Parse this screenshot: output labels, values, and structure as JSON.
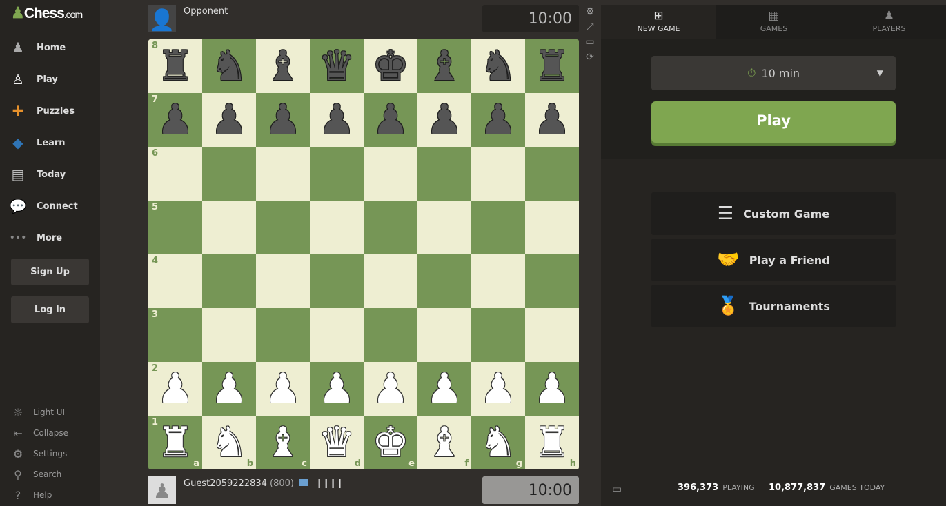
{
  "brand": {
    "name": "Chess",
    "suffix": ".com"
  },
  "sidebar": {
    "items": [
      {
        "label": "Home",
        "icon": "home-pawn-icon",
        "glyph": "♟",
        "color": "#aaa"
      },
      {
        "label": "Play",
        "icon": "play-hand-icon",
        "glyph": "♙",
        "color": "#eee"
      },
      {
        "label": "Puzzles",
        "icon": "puzzle-icon",
        "glyph": "✚",
        "color": "#e6912c"
      },
      {
        "label": "Learn",
        "icon": "graduation-cap-icon",
        "glyph": "◆",
        "color": "#2f74b5"
      },
      {
        "label": "Today",
        "icon": "newspaper-icon",
        "glyph": "▤",
        "color": "#bbb"
      },
      {
        "label": "Connect",
        "icon": "chat-bubbles-icon",
        "glyph": "💬",
        "color": "#ddd"
      },
      {
        "label": "More",
        "icon": "more-dots-icon",
        "glyph": "•••",
        "color": "#888"
      }
    ],
    "signup": "Sign Up",
    "login": "Log In",
    "footer": [
      {
        "label": "Light UI",
        "icon": "sun-icon",
        "glyph": "☼"
      },
      {
        "label": "Collapse",
        "icon": "collapse-icon",
        "glyph": "⇤"
      },
      {
        "label": "Settings",
        "icon": "gear-icon",
        "glyph": "⚙"
      },
      {
        "label": "Search",
        "icon": "search-icon",
        "glyph": "⚲"
      },
      {
        "label": "Help",
        "icon": "help-icon",
        "glyph": "?"
      }
    ]
  },
  "opponent": {
    "name": "Opponent",
    "clock": "10:00"
  },
  "player": {
    "name": "Guest2059222834",
    "rating": "(800)",
    "clock": "10:00",
    "flag_icon": "international-flag-icon",
    "connection_icon": "signal-bars-icon"
  },
  "board": {
    "light": "#eeeed2",
    "dark": "#769656",
    "ranks": [
      "8",
      "7",
      "6",
      "5",
      "4",
      "3",
      "2",
      "1"
    ],
    "files": [
      "a",
      "b",
      "c",
      "d",
      "e",
      "f",
      "g",
      "h"
    ],
    "position": [
      "rnbqkbnr",
      "pppppppp",
      "8",
      "8",
      "8",
      "8",
      "PPPPPPPP",
      "RNBQKBNR"
    ]
  },
  "board_tools": [
    "settings-icon",
    "fullscreen-icon",
    "theater-mode-icon",
    "flip-board-icon"
  ],
  "panel": {
    "tabs": [
      {
        "label": "NEW GAME",
        "icon": "plus-square-icon",
        "glyph": "⊞"
      },
      {
        "label": "GAMES",
        "icon": "checkerboard-icon",
        "glyph": "▦"
      },
      {
        "label": "PLAYERS",
        "icon": "players-icon",
        "glyph": "♟"
      }
    ],
    "time_control": "10 min",
    "play": "Play",
    "options": [
      {
        "label": "Custom Game",
        "icon": "sliders-icon",
        "glyph": "☰"
      },
      {
        "label": "Play a Friend",
        "icon": "handshake-icon",
        "glyph": "🤝"
      },
      {
        "label": "Tournaments",
        "icon": "medal-icon",
        "glyph": "🏅"
      }
    ],
    "stats": {
      "playing": "396,373",
      "playing_label": "PLAYING",
      "games": "10,877,837",
      "games_label": "GAMES TODAY"
    }
  },
  "accent": "#7fa650"
}
